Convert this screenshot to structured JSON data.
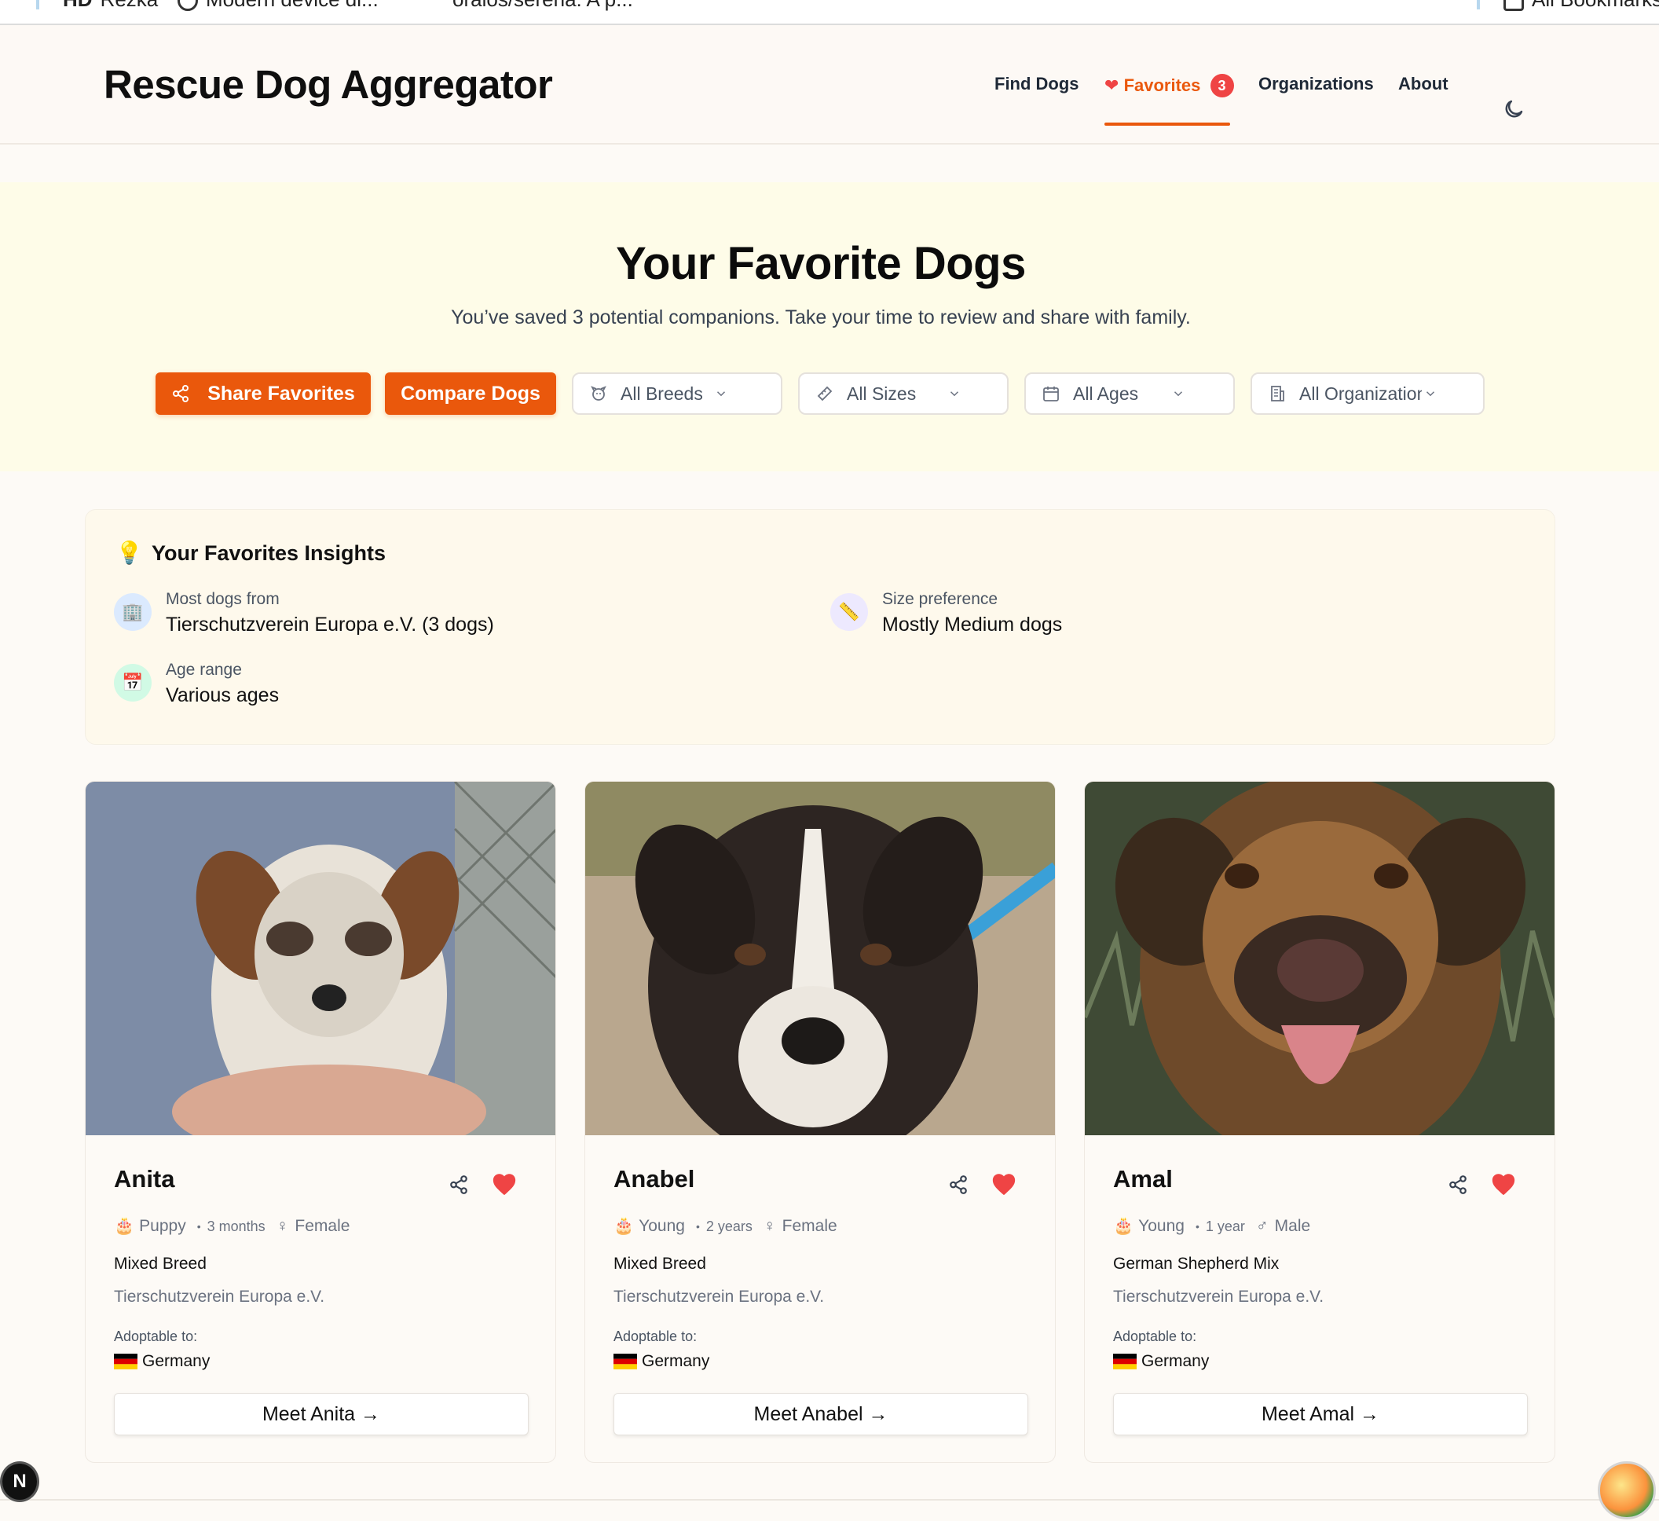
{
  "bookmarks": {
    "items": [
      "Rezka",
      "Modern device di...",
      "oraios/serena: A p...",
      "All Bookmarks"
    ]
  },
  "header": {
    "brand": "Rescue Dog Aggregator",
    "nav": {
      "find_dogs": "Find Dogs",
      "favorites": "Favorites",
      "favorites_count": "3",
      "organizations": "Organizations",
      "about": "About"
    },
    "theme_icon": "moon-icon"
  },
  "hero": {
    "title": "Your Favorite Dogs",
    "subtitle": "You’ve saved 3 potential companions. Take your time to review and share with family.",
    "share_button": "Share Favorites",
    "compare_button": "Compare Dogs",
    "filters": {
      "breeds": "All Breeds",
      "sizes": "All Sizes",
      "ages": "All Ages",
      "organizations": "All Organizations"
    }
  },
  "insights": {
    "title": "Your Favorites Insights",
    "most_from_label": "Most dogs from",
    "most_from_value": "Tierschutzverein Europa e.V. (3 dogs)",
    "size_label": "Size preference",
    "size_value": "Mostly Medium dogs",
    "age_label": "Age range",
    "age_value": "Various ages"
  },
  "dogs": [
    {
      "name": "Anita",
      "age_category": "Puppy",
      "age": "3 months",
      "gender": "Female",
      "breed": "Mixed Breed",
      "organization": "Tierschutzverein Europa e.V.",
      "adoptable_label": "Adoptable to:",
      "country": "Germany",
      "cta": "Meet Anita →"
    },
    {
      "name": "Anabel",
      "age_category": "Young",
      "age": "2 years",
      "gender": "Female",
      "breed": "Mixed Breed",
      "organization": "Tierschutzverein Europa e.V.",
      "adoptable_label": "Adoptable to:",
      "country": "Germany",
      "cta": "Meet Anabel →"
    },
    {
      "name": "Amal",
      "age_category": "Young",
      "age": "1 year",
      "gender": "Male",
      "breed": "German Shepherd Mix",
      "organization": "Tierschutzverein Europa e.V.",
      "adoptable_label": "Adoptable to:",
      "country": "Germany",
      "cta": "Meet Amal →"
    }
  ],
  "dev_badge": "N",
  "colors": {
    "accent": "#ea580c",
    "badge": "#ef4444",
    "hero_bg": "#fefce8"
  }
}
